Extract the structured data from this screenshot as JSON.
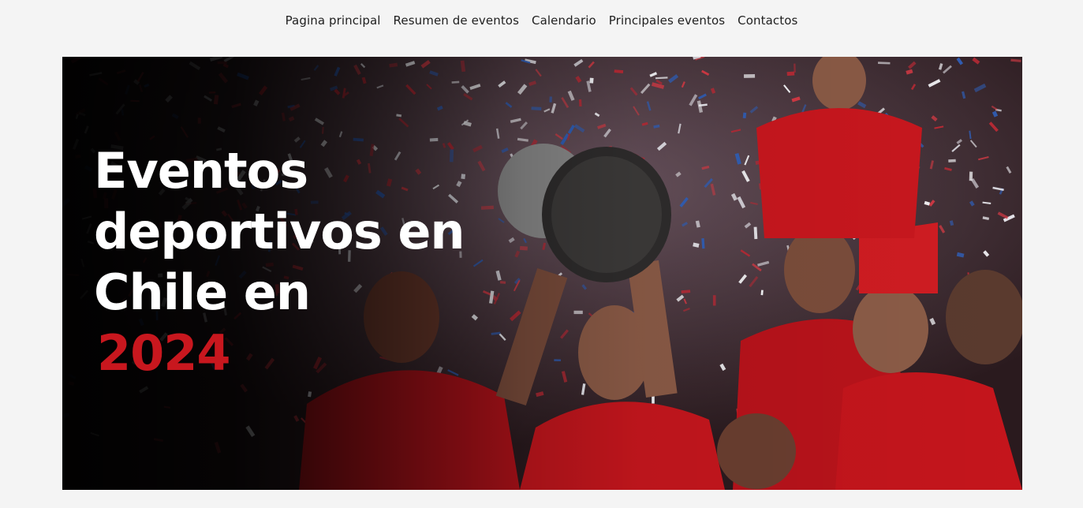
{
  "nav": {
    "items": [
      {
        "label": "Pagina principal"
      },
      {
        "label": "Resumen de eventos"
      },
      {
        "label": "Calendario"
      },
      {
        "label": "Principales eventos"
      },
      {
        "label": "Contactos"
      }
    ]
  },
  "hero": {
    "title_line1": "Eventos",
    "title_line2": "deportivos en",
    "title_line3": "Chile en",
    "title_year": "2024",
    "year_color": "#c8171e",
    "image_description_icon": "celebration-photo"
  }
}
